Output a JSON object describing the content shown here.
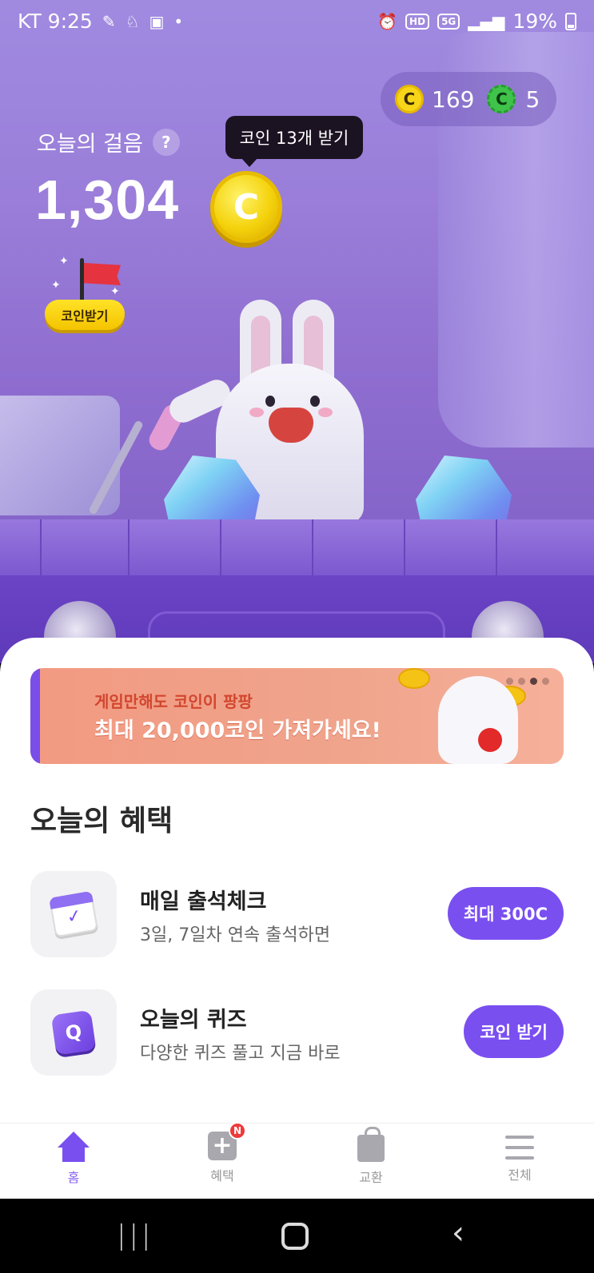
{
  "status_bar": {
    "carrier_time": "KT 9:25",
    "battery": "19%",
    "hd_label": "HD",
    "network_label": "5G"
  },
  "coins": {
    "gold_icon_label": "C",
    "gold_count": "169",
    "green_icon_label": "C",
    "green_count": "5"
  },
  "steps": {
    "label": "오늘의 걸음",
    "help": "?",
    "count": "1,304",
    "coin_label": "C",
    "tooltip": "코인 13개 받기"
  },
  "flag_button": {
    "label": "코인받기"
  },
  "banner": {
    "line1": "게임만해도 코인이 팡팡",
    "line2": "최대 20,000코인 가져가세요!",
    "page_dots": 4,
    "active_dot": 3
  },
  "benefits": {
    "title": "오늘의 혜택",
    "items": [
      {
        "title": "매일 출석체크",
        "subtitle": "3일, 7일차 연속 출석하면",
        "cta": "최대 300C",
        "icon": "calendar-check-icon"
      },
      {
        "title": "오늘의 퀴즈",
        "subtitle": "다양한 퀴즈 풀고 지금 바로",
        "cta": "코인 받기",
        "icon": "quiz-q-icon",
        "icon_label": "Q"
      }
    ]
  },
  "tabs": [
    {
      "label": "홈",
      "icon": "home-icon",
      "active": true
    },
    {
      "label": "혜택",
      "icon": "plus-box-icon",
      "badge": "N"
    },
    {
      "label": "교환",
      "icon": "shopping-bag-icon"
    },
    {
      "label": "전체",
      "icon": "menu-icon"
    }
  ],
  "colors": {
    "accent": "#7a4ff0",
    "hero_bg": "#9a7ed9",
    "coin_gold": "#f4d20c",
    "banner_bg": "#f29a82"
  }
}
